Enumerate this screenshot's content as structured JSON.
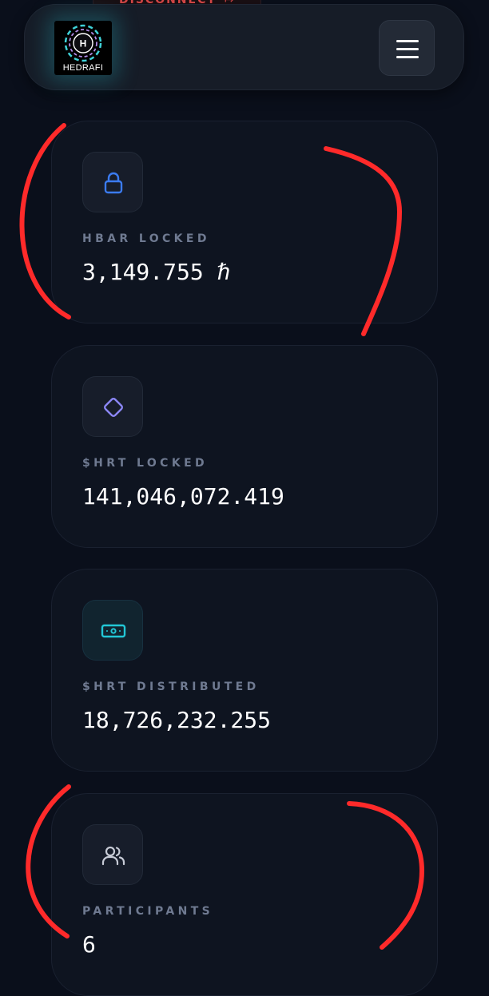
{
  "header": {
    "disconnect_label": "DISCONNECT",
    "logo_initial": "H",
    "logo_text": "HEDRAFI",
    "menu_icon": "hamburger-menu-icon"
  },
  "stats": [
    {
      "icon": "lock-icon",
      "label": "HBAR LOCKED",
      "value": "3,149.755 ℏ"
    },
    {
      "icon": "diamond-icon",
      "label": "$HRT LOCKED",
      "value": "141,046,072.419"
    },
    {
      "icon": "banknote-icon",
      "label": "$HRT DISTRIBUTED",
      "value": "18,726,232.255"
    },
    {
      "icon": "users-icon",
      "label": "PARTICIPANTS",
      "value": "6"
    }
  ],
  "colors": {
    "background": "#0a0f1b",
    "card": "#0e1420",
    "label": "#6f7a91",
    "lock_icon": "#3b7bf0",
    "diamond_icon": "#8b86f4",
    "banknote_icon": "#22c7d6",
    "users_icon": "#c7cbd6",
    "annotation": "#ff2a2a",
    "disconnect": "#e04a4a"
  }
}
